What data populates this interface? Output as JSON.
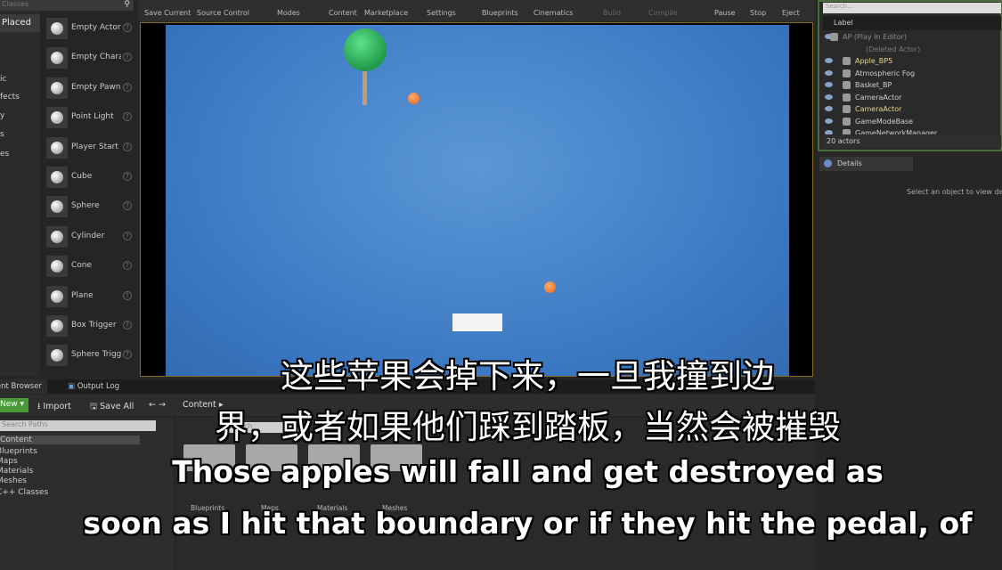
{
  "place_panel": {
    "search_placeholder": "Classes",
    "categories": [
      "Placed",
      "ic",
      "fects",
      "y",
      "s",
      "es"
    ],
    "items": [
      "Empty Actor",
      "Empty Character",
      "Empty Pawn",
      "Point Light",
      "Player Start",
      "Cube",
      "Sphere",
      "Cylinder",
      "Cone",
      "Plane",
      "Box Trigger",
      "Sphere Trigger"
    ]
  },
  "toolbar": {
    "buttons": [
      "Save Current",
      "Source Control",
      "Modes",
      "Content",
      "Marketplace",
      "Settings",
      "Blueprints",
      "Cinematics",
      "Build",
      "Compile",
      "Pause",
      "Stop",
      "Eject"
    ]
  },
  "outliner": {
    "search_placeholder": "Search...",
    "column": "Label",
    "rows": [
      {
        "label": "AP (Play In Editor)",
        "color": "#8a8a8a"
      },
      {
        "label": "(Deleted Actor)",
        "color": "#7a7a7a"
      },
      {
        "label": "Apple_BP5",
        "color": "#e6d58a"
      },
      {
        "label": "Atmospheric Fog",
        "color": "#cfcfcf"
      },
      {
        "label": "Basket_BP",
        "color": "#cfcfcf"
      },
      {
        "label": "CameraActor",
        "color": "#cfcfcf"
      },
      {
        "label": "CameraActor",
        "color": "#e6d58a"
      },
      {
        "label": "GameModeBase",
        "color": "#cfcfcf"
      },
      {
        "label": "GameNetworkManager",
        "color": "#cfcfcf"
      }
    ],
    "count": "20 actors"
  },
  "details": {
    "tab": "Details",
    "empty_message": "Select an object to view details."
  },
  "content_browser": {
    "tabs": [
      "Content Browser",
      "Output Log"
    ],
    "new_label": "New",
    "import_label": "Import",
    "save_all_label": "Save All",
    "breadcrumb": "Content",
    "paths_placeholder": "Search Paths",
    "paths": [
      "Content",
      "Blueprints",
      "Maps",
      "Materials",
      "Meshes",
      "C++ Classes"
    ],
    "search_placeholder": "Search",
    "folders": [
      "Blueprints",
      "Maps",
      "Materials",
      "Meshes"
    ]
  },
  "subtitles": [
    "这些苹果会掉下来，一旦我撞到边",
    "界，或者如果他们踩到踏板，当然会被摧毁",
    "Those apples will fall and get destroyed as",
    "soon as I hit that boundary or if they hit the pedal, of"
  ]
}
